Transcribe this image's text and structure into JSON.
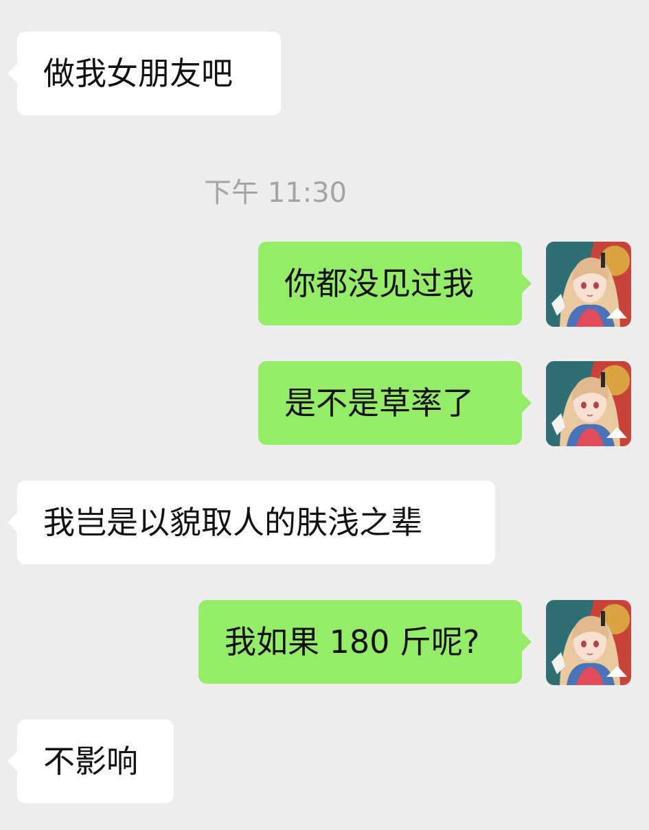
{
  "chat": {
    "timestamp": "下午 11:30",
    "messages": [
      {
        "from": "contact",
        "text": "做我女朋友吧"
      },
      {
        "from": "me",
        "text": "你都没见过我"
      },
      {
        "from": "me",
        "text": "是不是草率了"
      },
      {
        "from": "contact",
        "text": "我岂是以貌取人的肤浅之辈"
      },
      {
        "from": "me",
        "text": "我如果 180 斤呢?"
      },
      {
        "from": "contact",
        "text": "不影响"
      }
    ]
  },
  "colors": {
    "background": "#ededed",
    "incoming_bubble": "#ffffff",
    "outgoing_bubble": "#95ec69",
    "timestamp_text": "#a3a3a3",
    "message_text": "#111111"
  },
  "icons": {
    "my_avatar": "anime-girl-avatar-icon"
  }
}
